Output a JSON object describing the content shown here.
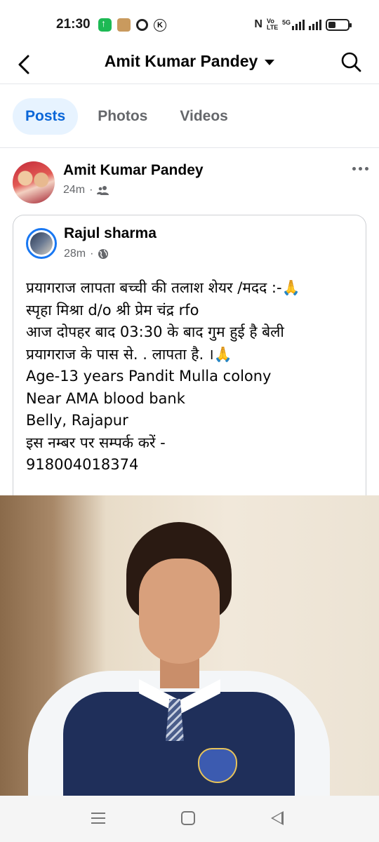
{
  "status_bar": {
    "time": "21:30",
    "icons": [
      "app-update-icon",
      "package-icon",
      "chrome-icon",
      "k-icon",
      "nfc-icon",
      "volte-icon",
      "signal-5g-icon",
      "signal-icon",
      "battery-icon"
    ],
    "network_label": "5G",
    "volte_label": "Vo LTE"
  },
  "header": {
    "title": "Amit Kumar Pandey"
  },
  "tabs": [
    {
      "label": "Posts",
      "active": true
    },
    {
      "label": "Photos",
      "active": false
    },
    {
      "label": "Videos",
      "active": false
    }
  ],
  "post": {
    "author": "Amit Kumar Pandey",
    "time": "24m",
    "separator": "·",
    "audience_icon": "friends-icon",
    "shared": {
      "author": "Rajul sharma",
      "time": "28m",
      "separator": "·",
      "audience_icon": "globe-icon",
      "text_lines": [
        "प्रयागराज लापता बच्ची की तलाश शेयर /मदद :-🙏",
        "स्पृहा मिश्रा  d/o श्री प्रेम चंद्र rfo",
        "आज दोपहर बाद 03:30 के बाद गुम हुई है बेली",
        "प्रयागराज के पास से. . लापता है. ।🙏",
        "Age-13 years  Pandit Mulla colony",
        "Near AMA blood bank",
        "Belly, Rajapur",
        "इस नम्बर पर सम्पर्क करें -",
        "918004018374"
      ]
    }
  },
  "colors": {
    "accent": "#0a66d8",
    "tab_active_bg": "#e7f3ff",
    "secondary_text": "#65676b",
    "divider": "#e4e6eb"
  }
}
